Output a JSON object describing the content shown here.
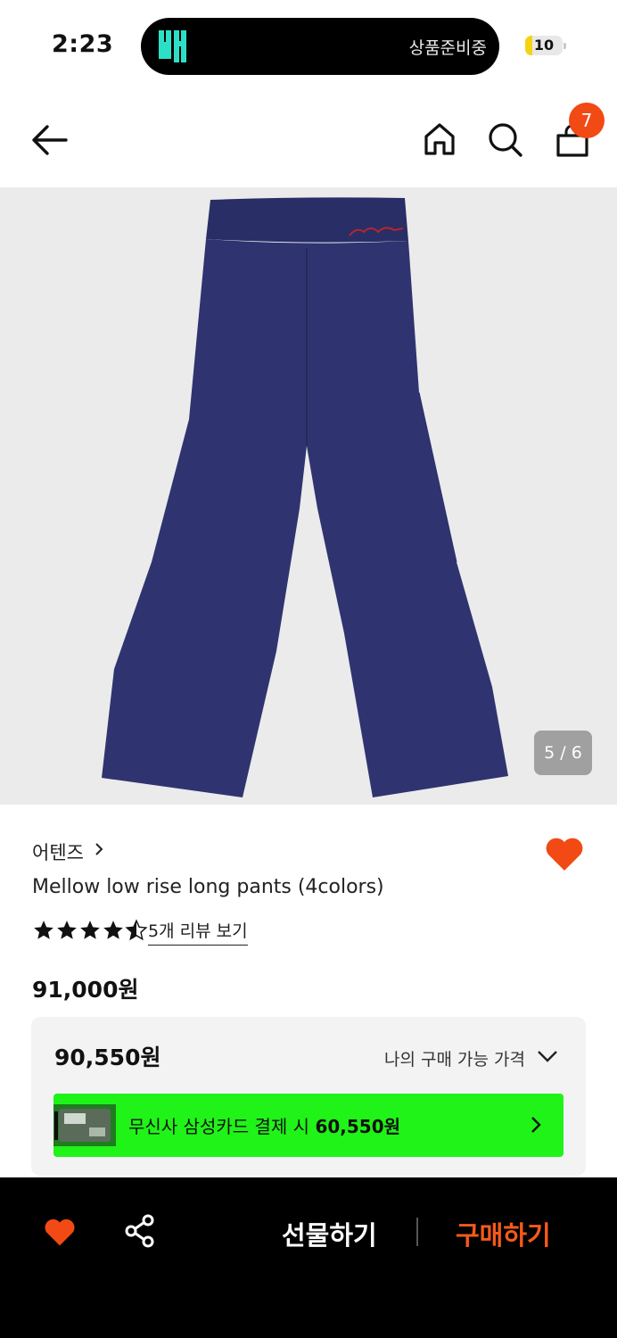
{
  "status_bar": {
    "time": "2:23",
    "island_app_name": "배민",
    "island_text": "상품준비중",
    "battery_level": "10",
    "battery_fraction": 0.1
  },
  "nav": {
    "back_icon": "arrow-left-icon",
    "home_icon": "home-icon",
    "search_icon": "search-icon",
    "cart_icon": "shopping-bag-icon",
    "cart_count": "7"
  },
  "gallery": {
    "counter": "5 / 6",
    "current": 5,
    "total": 6
  },
  "product": {
    "brand": "어텐즈",
    "name": "Mellow low rise long pants (4colors)",
    "rating": 4.5,
    "max_rating": 5,
    "review_link": "5개 리뷰 보기",
    "liked": true
  },
  "price": {
    "original": "91,000원",
    "current": "90,550원",
    "my_price_label": "나의 구매 가능 가격",
    "promo_prefix": "무신사 삼성카드 결제 시 ",
    "promo_price": "60,550원"
  },
  "bottom_bar": {
    "gift_label": "선물하기",
    "buy_label": "구매하기"
  },
  "colors": {
    "accent_orange": "#f14a14",
    "promo_green": "#20f318",
    "pants_navy": "#2f3470"
  }
}
